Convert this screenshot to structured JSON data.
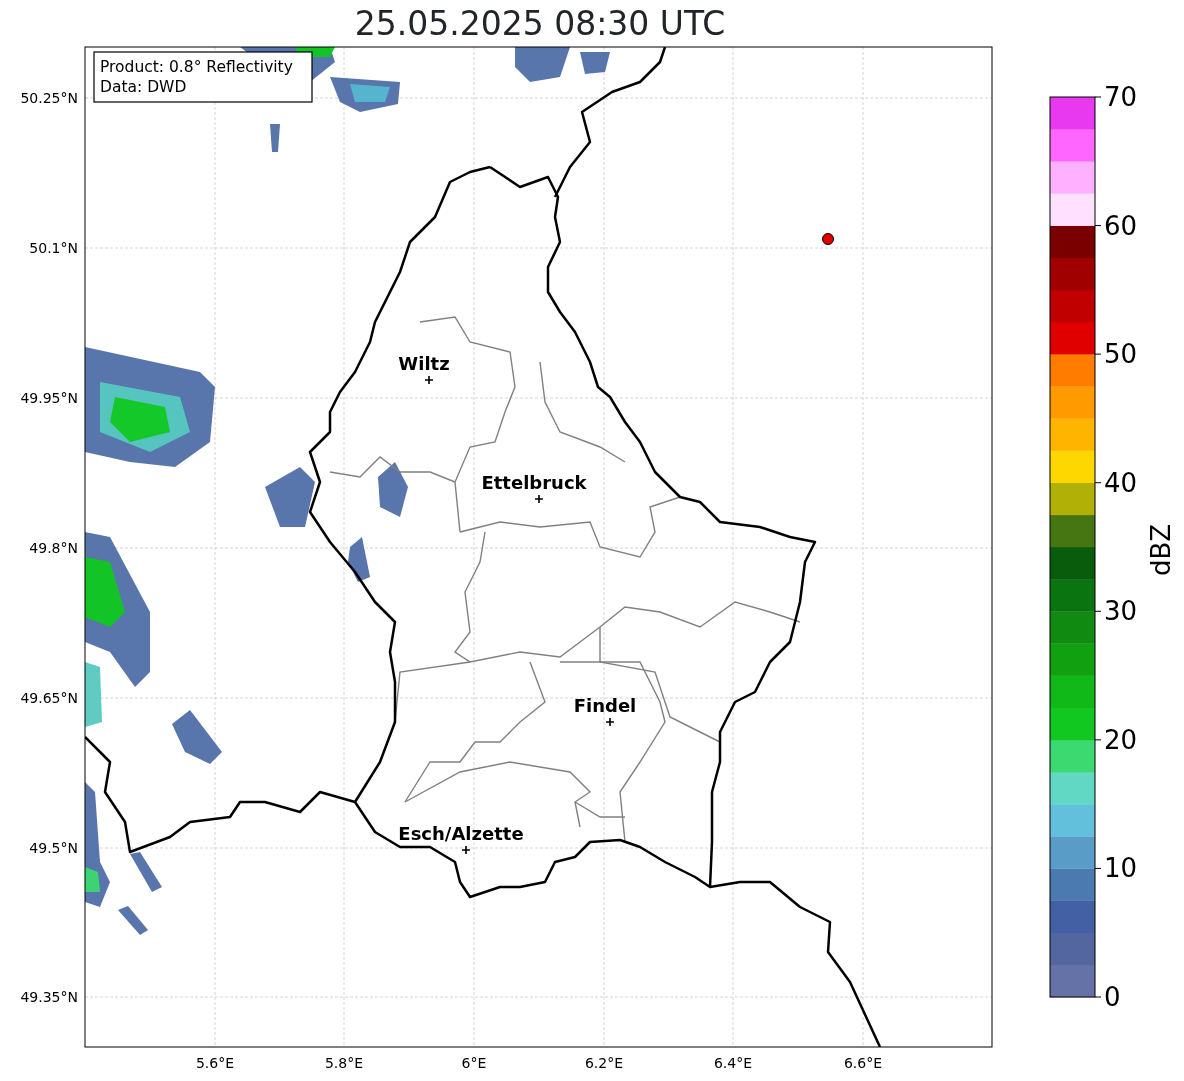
{
  "title": "25.05.2025 08:30 UTC",
  "info_box": [
    "Product: 0.8° Reflectivity",
    "Data: DWD"
  ],
  "map": {
    "y_ticks": [
      "50.25°N",
      "50.1°N",
      "49.95°N",
      "49.8°N",
      "49.65°N",
      "49.5°N",
      "49.35°N"
    ],
    "x_ticks": [
      "5.6°E",
      "5.8°E",
      "6°E",
      "6.2°E",
      "6.4°E",
      "6.6°E"
    ],
    "cities": [
      "Wiltz",
      "Ettelbruck",
      "Findel",
      "Esch/Alzette"
    ]
  },
  "colorbar": {
    "label": "dBZ",
    "ticks": [
      "70",
      "60",
      "50",
      "40",
      "30",
      "20",
      "10",
      "0"
    ],
    "segments": [
      {
        "color": "#6472a8"
      },
      {
        "color": "#53669f"
      },
      {
        "color": "#4460a4"
      },
      {
        "color": "#4a7ab0"
      },
      {
        "color": "#5a9cc8"
      },
      {
        "color": "#62c0dc"
      },
      {
        "color": "#60d8c4"
      },
      {
        "color": "#3cd870"
      },
      {
        "color": "#10c820"
      },
      {
        "color": "#10b818"
      },
      {
        "color": "#10a010"
      },
      {
        "color": "#108a10"
      },
      {
        "color": "#0a7410"
      },
      {
        "color": "#085c0c"
      },
      {
        "color": "#467612"
      },
      {
        "color": "#b0b006"
      },
      {
        "color": "#ffd700"
      },
      {
        "color": "#ffb400"
      },
      {
        "color": "#ff9a00"
      },
      {
        "color": "#ff7c00"
      },
      {
        "color": "#e00000"
      },
      {
        "color": "#c00000"
      },
      {
        "color": "#a00000"
      },
      {
        "color": "#7a0000"
      },
      {
        "color": "#ffe0ff"
      },
      {
        "color": "#ffb0ff"
      },
      {
        "color": "#ff66ff"
      },
      {
        "color": "#e838f0"
      }
    ]
  }
}
